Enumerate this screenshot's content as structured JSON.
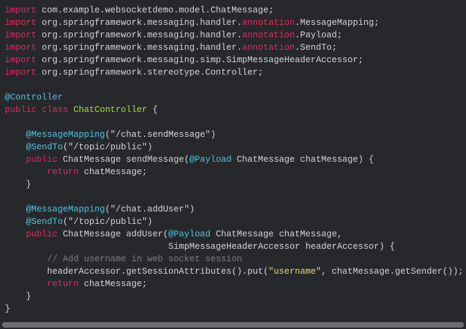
{
  "colors": {
    "background": "#26282c",
    "keyword": "#f0245f",
    "annotation": "#4fc4df",
    "class": "#a6e22e",
    "string": "#e6db74",
    "comment": "#7d7d7d",
    "text": "#d6d6d6"
  },
  "code_lines": [
    [
      [
        "kw",
        "import"
      ],
      [
        "tx",
        " com.example.websocketdemo.model.ChatMessage;"
      ]
    ],
    [
      [
        "kw",
        "import"
      ],
      [
        "tx",
        " org.springframework.messaging.handler."
      ],
      [
        "kw",
        "annotation"
      ],
      [
        "tx",
        ".MessageMapping;"
      ]
    ],
    [
      [
        "kw",
        "import"
      ],
      [
        "tx",
        " org.springframework.messaging.handler."
      ],
      [
        "kw",
        "annotation"
      ],
      [
        "tx",
        ".Payload;"
      ]
    ],
    [
      [
        "kw",
        "import"
      ],
      [
        "tx",
        " org.springframework.messaging.handler."
      ],
      [
        "kw",
        "annotation"
      ],
      [
        "tx",
        ".SendTo;"
      ]
    ],
    [
      [
        "kw",
        "import"
      ],
      [
        "tx",
        " org.springframework.messaging.simp.SimpMessageHeaderAccessor;"
      ]
    ],
    [
      [
        "kw",
        "import"
      ],
      [
        "tx",
        " org.springframework.stereotype.Controller;"
      ]
    ],
    [],
    [
      [
        "an",
        "@Controller"
      ]
    ],
    [
      [
        "kw",
        "public"
      ],
      [
        "tx",
        " "
      ],
      [
        "kw",
        "class"
      ],
      [
        "tx",
        " "
      ],
      [
        "cls",
        "ChatController"
      ],
      [
        "tx",
        " {"
      ]
    ],
    [],
    [
      [
        "tx",
        "    "
      ],
      [
        "an",
        "@MessageMapping"
      ],
      [
        "tx",
        "(\"/chat.sendMessage\")"
      ]
    ],
    [
      [
        "tx",
        "    "
      ],
      [
        "an",
        "@SendTo"
      ],
      [
        "tx",
        "(\"/topic/public\")"
      ]
    ],
    [
      [
        "tx",
        "    "
      ],
      [
        "kw",
        "public"
      ],
      [
        "tx",
        " ChatMessage sendMessage("
      ],
      [
        "an",
        "@Payload"
      ],
      [
        "tx",
        " ChatMessage chatMessage) {"
      ]
    ],
    [
      [
        "tx",
        "        "
      ],
      [
        "kw",
        "return"
      ],
      [
        "tx",
        " chatMessage;"
      ]
    ],
    [
      [
        "tx",
        "    }"
      ]
    ],
    [],
    [
      [
        "tx",
        "    "
      ],
      [
        "an",
        "@MessageMapping"
      ],
      [
        "tx",
        "(\"/chat.addUser\")"
      ]
    ],
    [
      [
        "tx",
        "    "
      ],
      [
        "an",
        "@SendTo"
      ],
      [
        "tx",
        "(\"/topic/public\")"
      ]
    ],
    [
      [
        "tx",
        "    "
      ],
      [
        "kw",
        "public"
      ],
      [
        "tx",
        " ChatMessage addUser("
      ],
      [
        "an",
        "@Payload"
      ],
      [
        "tx",
        " ChatMessage chatMessage,"
      ]
    ],
    [
      [
        "tx",
        "                               SimpMessageHeaderAccessor headerAccessor) {"
      ]
    ],
    [
      [
        "tx",
        "        "
      ],
      [
        "cm",
        "// Add username in web socket session"
      ]
    ],
    [
      [
        "tx",
        "        headerAccessor.getSessionAttributes().put("
      ],
      [
        "str",
        "\"username\""
      ],
      [
        "tx",
        ", chatMessage.getSender());"
      ]
    ],
    [
      [
        "tx",
        "        "
      ],
      [
        "kw",
        "return"
      ],
      [
        "tx",
        " chatMessage;"
      ]
    ],
    [
      [
        "tx",
        "    }"
      ]
    ],
    [
      [
        "tx",
        "}"
      ]
    ]
  ]
}
